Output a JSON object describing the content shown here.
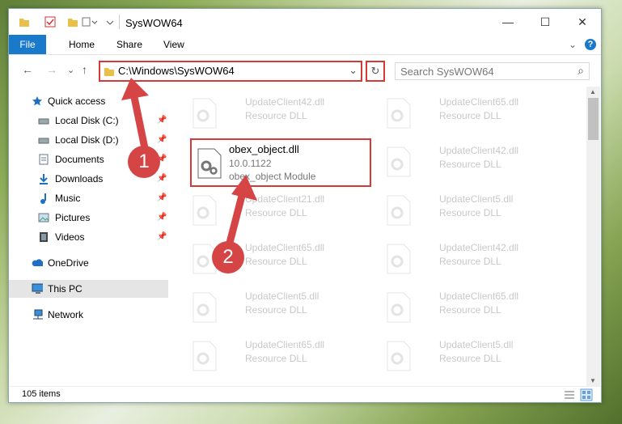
{
  "window": {
    "title": "SysWOW64",
    "minimize": "—",
    "maximize": "☐",
    "close": "✕"
  },
  "ribbon": {
    "file": "File",
    "tabs": [
      "Home",
      "Share",
      "View"
    ],
    "expand": "⌄",
    "help": "?"
  },
  "address": {
    "back": "←",
    "forward": "→",
    "recent": "⌄",
    "up": "↑",
    "path": "C:\\Windows\\SysWOW64",
    "dropdown": "⌄",
    "refresh": "↻",
    "search_placeholder": "Search SysWOW64",
    "search_icon": "⌕"
  },
  "nav": {
    "quick_access": "Quick access",
    "items": [
      {
        "label": "Local Disk (C:)",
        "icon": "drive-icon"
      },
      {
        "label": "Local Disk (D:)",
        "icon": "drive-icon"
      },
      {
        "label": "Documents",
        "icon": "documents-icon"
      },
      {
        "label": "Downloads",
        "icon": "downloads-icon"
      },
      {
        "label": "Music",
        "icon": "music-icon"
      },
      {
        "label": "Pictures",
        "icon": "pictures-icon"
      },
      {
        "label": "Videos",
        "icon": "videos-icon"
      }
    ],
    "onedrive": "OneDrive",
    "this_pc": "This PC",
    "network": "Network"
  },
  "files": [
    {
      "name": "UpdateClient42.dll",
      "type": "Resource DLL"
    },
    {
      "name": "UpdateClient65.dll",
      "type": "Resource DLL"
    },
    {
      "name": "obex_object.dll",
      "version": "10.0.1122",
      "type": "obex_object Module"
    },
    {
      "name": "UpdateClient42.dll",
      "type": "Resource DLL"
    },
    {
      "name": "UpdateClient21.dll",
      "type": "Resource DLL"
    },
    {
      "name": "UpdateClient5.dll",
      "type": "Resource DLL"
    },
    {
      "name": "UpdateClient65.dll",
      "type": "Resource DLL"
    },
    {
      "name": "UpdateClient42.dll",
      "type": "Resource DLL"
    },
    {
      "name": "UpdateClient5.dll",
      "type": "Resource DLL"
    },
    {
      "name": "UpdateClient65.dll",
      "type": "Resource DLL"
    },
    {
      "name": "UpdateClient65.dll",
      "type": "Resource DLL"
    },
    {
      "name": "UpdateClient5.dll",
      "type": "Resource DLL"
    }
  ],
  "status": {
    "count": "105 items"
  },
  "annotations": {
    "step1": "1",
    "step2": "2"
  },
  "colors": {
    "accent": "#1979ca",
    "highlight": "#d63838",
    "selection": "#e5e5e5"
  }
}
